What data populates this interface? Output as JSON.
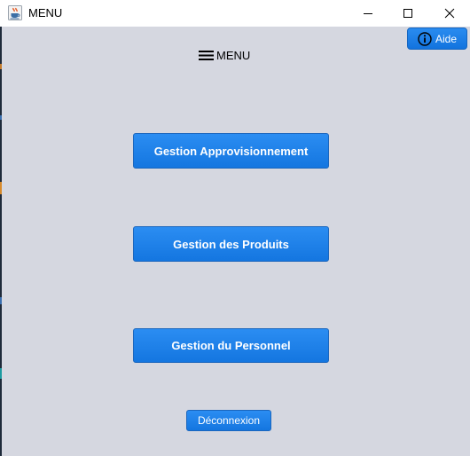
{
  "window": {
    "title": "MENU",
    "icon": "java-cup-icon"
  },
  "header": {
    "menu_label": "MENU",
    "menu_icon": "hamburger-icon"
  },
  "help": {
    "label": "Aide",
    "icon": "info-icon"
  },
  "buttons": {
    "approvisionnement": "Gestion Approvisionnement",
    "produits": "Gestion des Produits",
    "personnel": "Gestion du Personnel",
    "logout": "Déconnexion"
  },
  "colors": {
    "panel_background": "#d5d7e0",
    "button_blue": "#1e82ea"
  }
}
